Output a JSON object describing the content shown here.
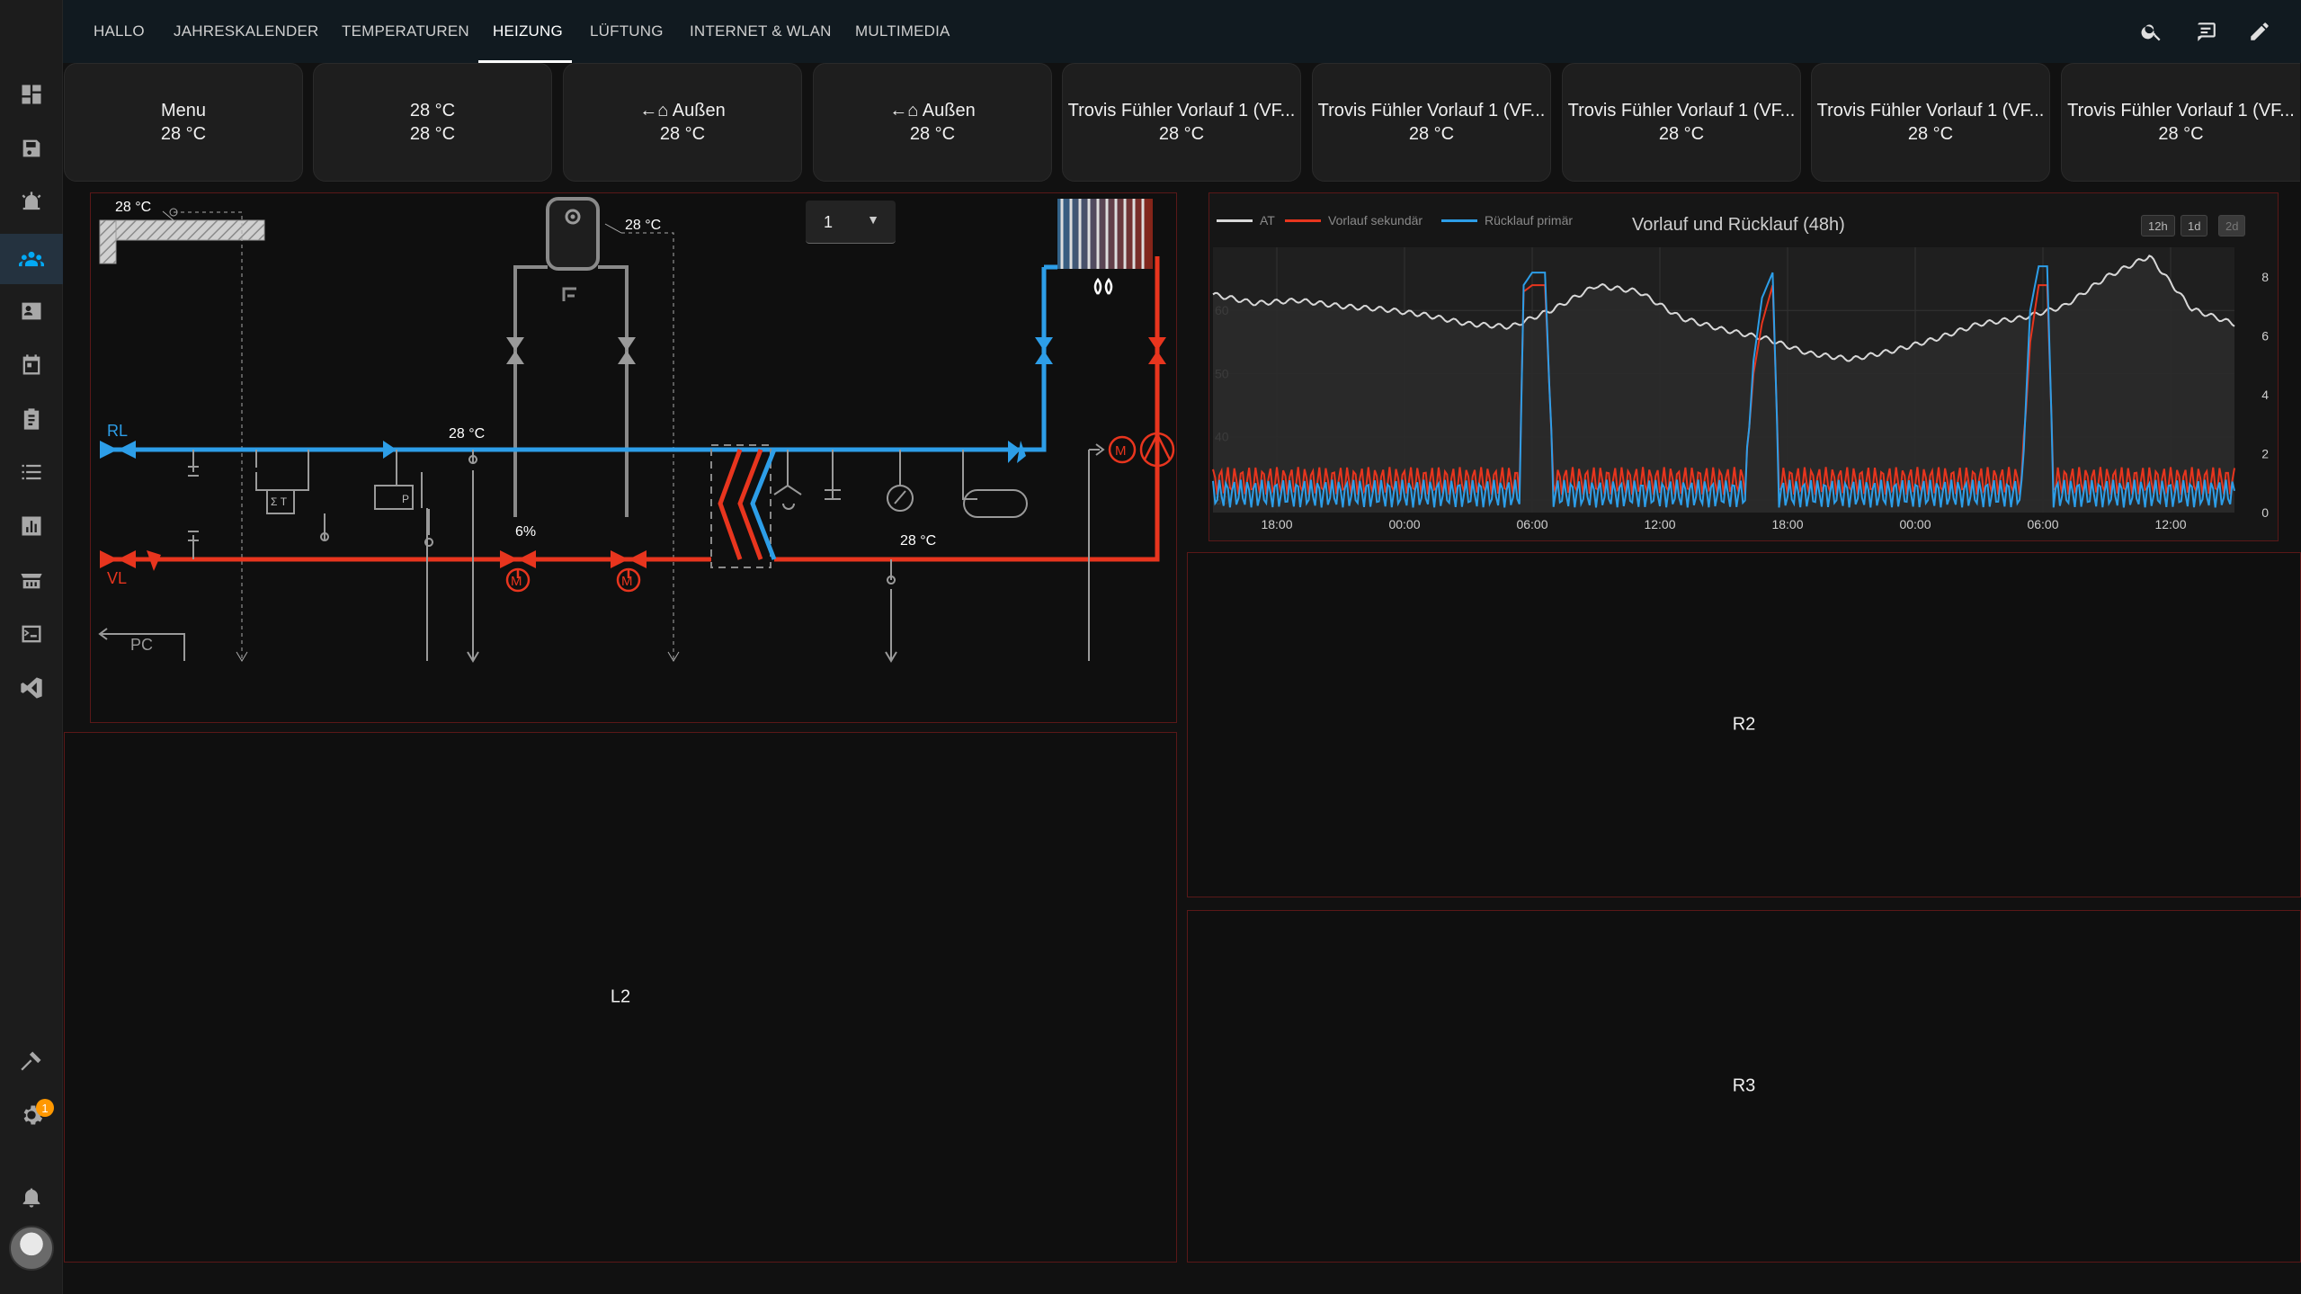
{
  "nav": {
    "tabs": [
      {
        "label": "HALLO"
      },
      {
        "label": "JAHRESKALENDER"
      },
      {
        "label": "TEMPERATUREN"
      },
      {
        "label": "HEIZUNG"
      },
      {
        "label": "LÜFTUNG"
      },
      {
        "label": "INTERNET & WLAN"
      },
      {
        "label": "MULTIMEDIA"
      }
    ],
    "active_tab": "HEIZUNG"
  },
  "sidebar": {
    "items": [
      "overview-icon",
      "energy-icon",
      "alarm-icon",
      "people-icon",
      "badge-icon",
      "calendar-icon",
      "clipboard-icon",
      "list-icon",
      "chart-icon",
      "hacs-icon",
      "terminal-icon",
      "vscode-icon"
    ],
    "bottom": [
      "hammer-icon",
      "settings-icon",
      "bell-icon"
    ],
    "settings_badge": "1"
  },
  "buttons": [
    {
      "name": "Menu",
      "state": "28 °C"
    },
    {
      "name": "28 °C",
      "state": "28 °C"
    },
    {
      "name": "←⌂ Außen",
      "state": "28 °C"
    },
    {
      "name": "←⌂ Außen",
      "state": "28 °C"
    },
    {
      "name": "Trovis Fühler Vorlauf 1 (VF...",
      "state": "28 °C"
    },
    {
      "name": "Trovis Fühler Vorlauf 1 (VF...",
      "state": "28 °C"
    },
    {
      "name": "Trovis Fühler Vorlauf 1 (VF...",
      "state": "28 °C"
    },
    {
      "name": "Trovis Fühler Vorlauf 1 (VF...",
      "state": "28 °C"
    },
    {
      "name": "Trovis Fühler Vorlauf 1 (VF...",
      "state": "28 °C"
    }
  ],
  "diagram": {
    "outside_temp": "28 °C",
    "tank_temp": "28 °C",
    "return_temp": "28 °C",
    "flow_temp": "28 °C",
    "valve_percent": "6%",
    "label_rl": "RL",
    "label_vl": "VL",
    "label_pc": "PC",
    "sigma_label": "Σ T",
    "p_label": "P",
    "motor_label": "M",
    "selector_value": "1",
    "colors": {
      "return": "#2d9ee8",
      "flow": "#e8351e",
      "grey": "#8a8a8a"
    }
  },
  "panels": {
    "l2": "L2",
    "r2": "R2",
    "r3": "R3"
  },
  "chart_data": {
    "type": "line",
    "title": "Vorlauf und Rücklauf (48h)",
    "range_buttons": [
      "12h",
      "1d",
      "2d"
    ],
    "selected_range": "2d",
    "x_ticks": [
      "18:00",
      "00:00",
      "06:00",
      "12:00",
      "18:00",
      "00:00",
      "06:00",
      "12:00"
    ],
    "y_left_ticks": [
      30,
      40,
      50,
      60
    ],
    "y_right_ticks": [
      0,
      2,
      4,
      6,
      8
    ],
    "ylim_left": [
      28,
      70
    ],
    "ylim_right": [
      0,
      9
    ],
    "series": [
      {
        "name": "AT",
        "color": "#d8d8d8",
        "axis": "right",
        "x": [
          0,
          2,
          4,
          6,
          8,
          10,
          12,
          14,
          16,
          18,
          20,
          22,
          24,
          26,
          28,
          30,
          32,
          34,
          36,
          38,
          40,
          42,
          44,
          46,
          48
        ],
        "values": [
          7.4,
          7.1,
          7.2,
          7.0,
          6.9,
          6.7,
          6.4,
          6.3,
          6.9,
          7.7,
          7.5,
          6.6,
          6.2,
          5.9,
          5.4,
          5.2,
          5.5,
          5.9,
          6.4,
          6.6,
          7.0,
          8.0,
          8.7,
          6.9,
          6.4
        ]
      },
      {
        "name": "Vorlauf sekundär",
        "color": "#e8351e",
        "axis": "left",
        "x": [
          0,
          5,
          10,
          14.4,
          14.6,
          15,
          15.6,
          16,
          20,
          25,
          25.4,
          25.8,
          26.3,
          26.6,
          32,
          38,
          38.4,
          38.8,
          39.2,
          39.5,
          48
        ],
        "values": [
          33,
          33,
          33,
          33,
          63,
          64,
          64,
          33,
          33,
          33,
          50,
          58,
          64,
          33,
          33,
          33,
          55,
          64,
          64,
          33,
          33
        ]
      },
      {
        "name": "Rücklauf primär",
        "color": "#2d9ee8",
        "axis": "left",
        "x": [
          0,
          5,
          10,
          14.4,
          14.6,
          15,
          15.6,
          16,
          20,
          25,
          25.4,
          25.8,
          26.3,
          26.6,
          32,
          38,
          38.4,
          38.8,
          39.2,
          39.5,
          48
        ],
        "values": [
          31,
          31,
          31,
          31,
          64,
          66,
          66,
          31,
          31,
          31,
          52,
          62,
          66,
          31,
          31,
          31,
          60,
          67,
          67,
          31,
          31
        ]
      }
    ]
  }
}
